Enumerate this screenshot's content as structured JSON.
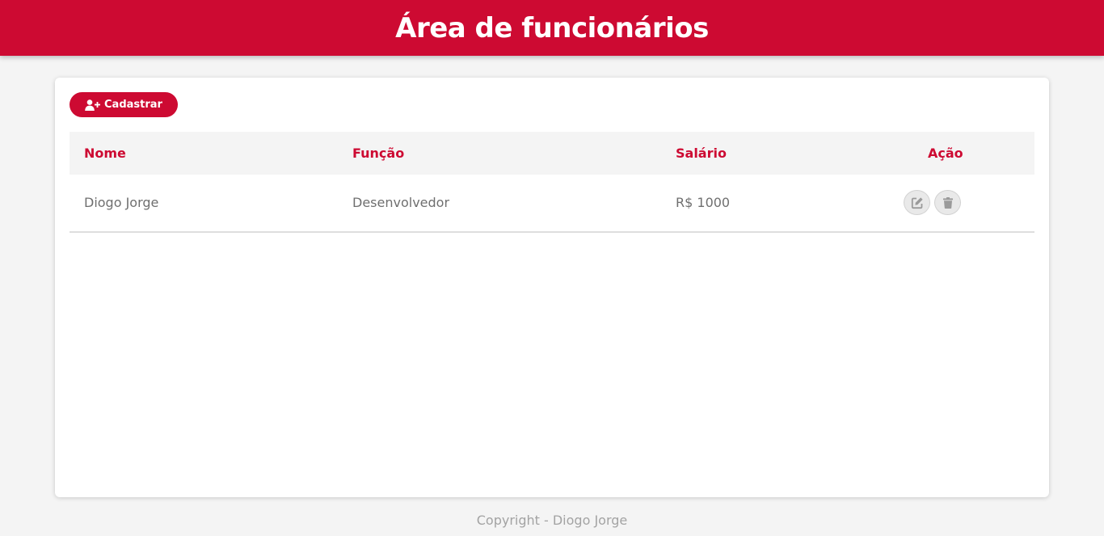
{
  "header": {
    "title": "Área de funcionários"
  },
  "toolbar": {
    "add_label": "Cadastrar",
    "add_icon": "user-plus-icon"
  },
  "table": {
    "columns": {
      "name": "Nome",
      "role": "Função",
      "salary": "Salário",
      "action": "Ação"
    },
    "rows": [
      {
        "name": "Diogo Jorge",
        "role": "Desenvolvedor",
        "salary": "R$ 1000"
      }
    ],
    "row_actions": [
      "edit-icon",
      "trash-icon"
    ]
  },
  "footer": {
    "copyright": "Copyright - Diogo Jorge"
  },
  "colors": {
    "brand": "#cd0a32",
    "background": "#f4f4f4",
    "text_muted": "#6f6f6f"
  }
}
